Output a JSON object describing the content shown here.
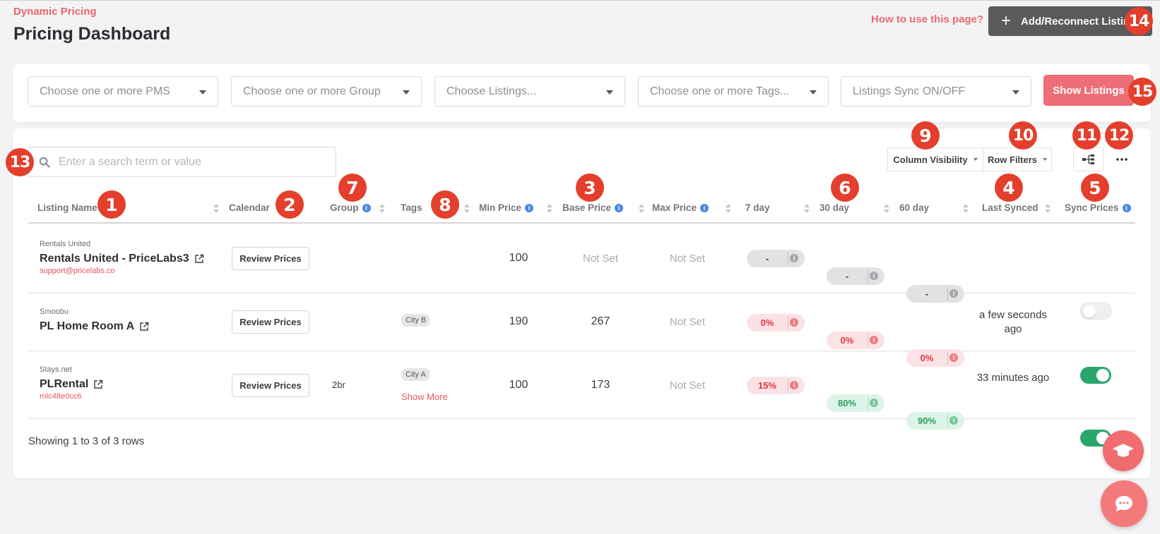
{
  "header": {
    "breadcrumb": "Dynamic Pricing",
    "title": "Pricing Dashboard",
    "help_link": "How to use this page?",
    "add_button": "Add/Reconnect Listings"
  },
  "filters": {
    "pms_placeholder": "Choose one or more PMS",
    "group_placeholder": "Choose one or more Group",
    "listings_placeholder": "Choose Listings...",
    "tags_placeholder": "Choose one or more Tags...",
    "sync_placeholder": "Listings Sync ON/OFF",
    "show_button": "Show Listings"
  },
  "toolbar": {
    "search_placeholder": "Enter a search term or value",
    "column_visibility": "Column Visibility",
    "row_filters": "Row Filters"
  },
  "columns": {
    "listing_name": "Listing Name",
    "calendar": "Calendar",
    "group": "Group",
    "tags": "Tags",
    "min_price": "Min Price",
    "base_price": "Base Price",
    "max_price": "Max Price",
    "d7": "7 day",
    "d30": "30 day",
    "d60": "60 day",
    "last_synced": "Last Synced",
    "sync_prices": "Sync Prices"
  },
  "rows": [
    {
      "pms": "Rentals United",
      "name": "Rentals United - PriceLabs3",
      "sub": "support@pricelabs.co",
      "calendar_button": "Review Prices",
      "group": "",
      "tags": [],
      "min_price": "100",
      "base_price": "Not Set",
      "max_price": "Not Set",
      "d7": "-",
      "d30": "-",
      "d60": "-",
      "last_synced": "",
      "sync_on": false
    },
    {
      "pms": "Smoobu",
      "name": "PL Home Room A",
      "sub": "",
      "calendar_button": "Review Prices",
      "group": "",
      "tags": [
        "City B"
      ],
      "min_price": "190",
      "base_price": "267",
      "max_price": "Not Set",
      "d7": "0%",
      "d30": "0%",
      "d60": "0%",
      "last_synced": "a few seconds ago",
      "sync_on": true
    },
    {
      "pms": "Stays.net",
      "name": "PLRental",
      "sub": "rnlc48e0cc6",
      "calendar_button": "Review Prices",
      "group": "2br",
      "tags": [
        "City A"
      ],
      "show_more": "Show More",
      "min_price": "100",
      "base_price": "173",
      "max_price": "Not Set",
      "d7": "15%",
      "d30": "80%",
      "d60": "90%",
      "last_synced": "33 minutes ago",
      "sync_on": true
    }
  ],
  "footer": "Showing 1 to 3 of 3 rows",
  "markers": [
    "1",
    "2",
    "3",
    "4",
    "5",
    "6",
    "7",
    "8",
    "9",
    "10",
    "11",
    "12",
    "13",
    "14",
    "15"
  ],
  "colors": {
    "accent": "#ee6e77",
    "marker": "#e33f2c",
    "toggle_on": "#29a76b",
    "info": "#4d88e4"
  }
}
